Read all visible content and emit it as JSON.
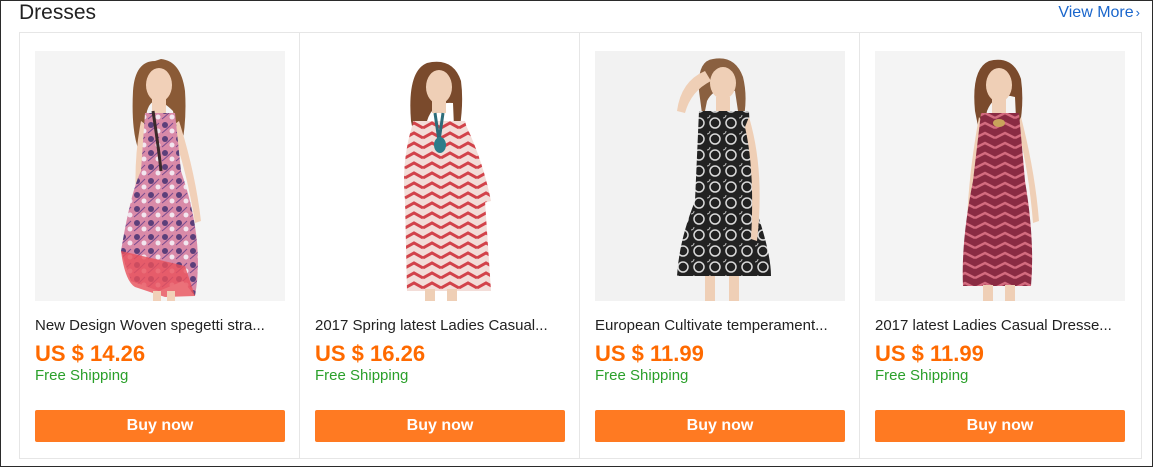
{
  "section": {
    "title": "Dresses",
    "view_more": "View More",
    "view_more_icon": "chevron-right-icon"
  },
  "colors": {
    "price": "#ff6a00",
    "shipping": "#2aa02a",
    "button": "#ff7a22",
    "link": "#1a66cc"
  },
  "products": [
    {
      "title": "New Design Woven spegetti stra...",
      "price": "US $ 14.26",
      "shipping": "Free Shipping",
      "button": "Buy now"
    },
    {
      "title": "2017 Spring latest Ladies Casual...",
      "price": "US $ 16.26",
      "shipping": "Free Shipping",
      "button": "Buy now"
    },
    {
      "title": "European Cultivate temperament...",
      "price": "US $ 11.99",
      "shipping": "Free Shipping",
      "button": "Buy now"
    },
    {
      "title": "2017 latest Ladies Casual Dresse...",
      "price": "US $ 11.99",
      "shipping": "Free Shipping",
      "button": "Buy now"
    }
  ]
}
